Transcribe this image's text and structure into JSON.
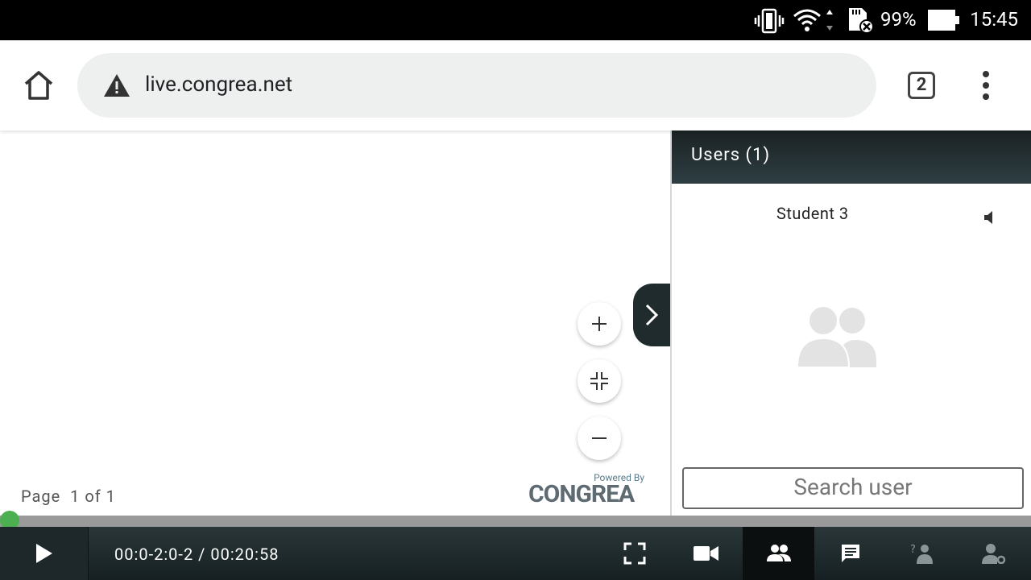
{
  "statusbar": {
    "battery": "99%",
    "time": "15:45"
  },
  "browser": {
    "url": "live.congrea.net",
    "tab_count": "2"
  },
  "stage": {
    "page_label": "Page",
    "page_value": "1 of 1",
    "powered_by": "Powered By",
    "brand": "CONGREA"
  },
  "users_panel": {
    "title": "Users (1)",
    "users": [
      {
        "name": "Student 3"
      }
    ],
    "search_placeholder": "Search user"
  },
  "player": {
    "time_display": "00:0-2:0-2 / 00:20:58",
    "progress": 0.0
  },
  "colors": {
    "accent_green": "#4caf50",
    "header_dark": "#1f2b2c"
  }
}
